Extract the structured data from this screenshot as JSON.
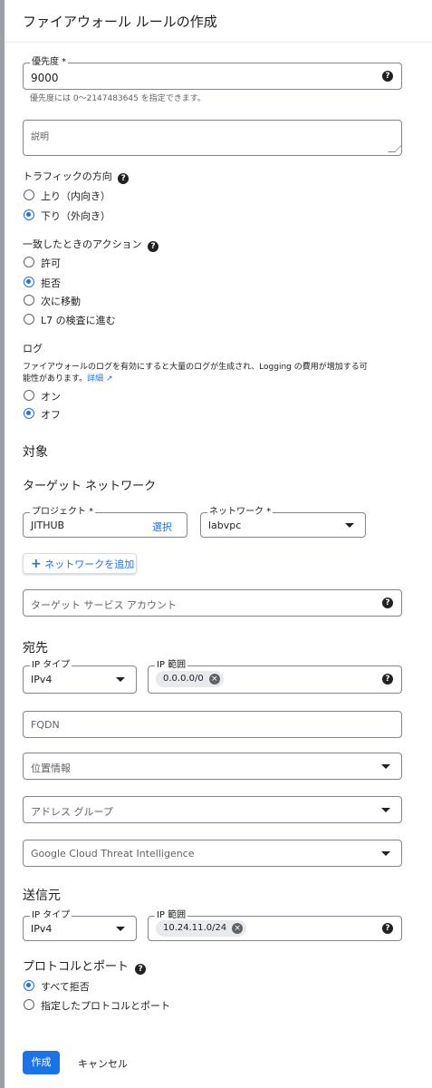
{
  "header": {
    "title": "ファイアウォール ルールの作成"
  },
  "priority": {
    "label": "優先度 *",
    "value": "9000",
    "hint": "優先度には 0～2147483645 を指定できます。"
  },
  "description": {
    "label": "説明"
  },
  "traffic": {
    "title": "トラフィックの方向",
    "options": [
      "上り（内向き）",
      "下り（外向き）"
    ],
    "selected": 1
  },
  "action": {
    "title": "一致したときのアクション",
    "options": [
      "許可",
      "拒否",
      "次に移動",
      "L7 の検査に進む"
    ],
    "selected": 1
  },
  "logs": {
    "title": "ログ",
    "desc_line1": "ファイアウォールのログを有効にすると大量のログが生成され、Logging の費用が増加する可",
    "desc_line2": "能性があります。",
    "details_link": "詳細",
    "options": [
      "オン",
      "オフ"
    ],
    "selected": 1
  },
  "target": {
    "title": "対象",
    "network_title": "ターゲット ネットワーク",
    "project_label": "プロジェクト *",
    "project_value": "JITHUB",
    "select_link": "選択",
    "network_label": "ネットワーク *",
    "network_value": "labvpc",
    "add_network": "ネットワークを追加",
    "service_account_placeholder": "ターゲット サービス アカウント"
  },
  "destination": {
    "title": "宛先",
    "ip_type_label": "IP タイプ",
    "ip_type_value": "IPv4",
    "ip_range_label": "IP 範囲",
    "ip_range_chip": "0.0.0.0/0",
    "fqdn": "FQDN",
    "geo": "位置情報",
    "address_group": "アドレス グループ",
    "threat_intel": "Google Cloud Threat Intelligence"
  },
  "source": {
    "title": "送信元",
    "ip_type_label": "IP タイプ",
    "ip_type_value": "IPv4",
    "ip_range_label": "IP 範囲",
    "ip_range_chip": "10.24.11.0/24"
  },
  "protocols": {
    "title": "プロトコルとポート",
    "options": [
      "すべて拒否",
      "指定したプロトコルとポート"
    ],
    "selected": 0
  },
  "footer": {
    "create": "作成",
    "cancel": "キャンセル"
  },
  "colors": {
    "accent": "#1a73e8",
    "text": "#202124",
    "muted": "#5f6368",
    "border": "#80868b"
  }
}
